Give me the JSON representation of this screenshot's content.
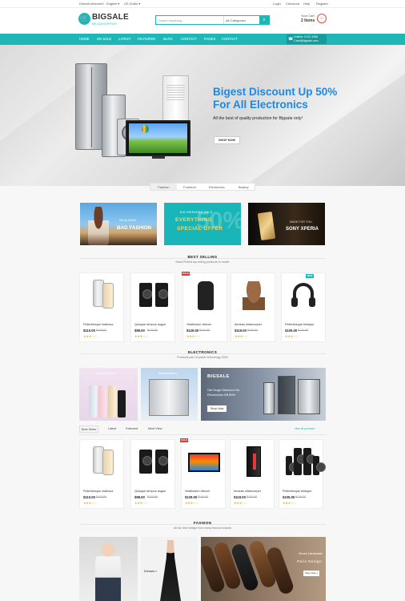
{
  "topbar": {
    "welcome": "Default welcome!",
    "language": "English ▾",
    "currency": "US Dollar ▾",
    "links": [
      "Login",
      "Checkout",
      "Help",
      "Register"
    ]
  },
  "header": {
    "logo": "BIGSALE",
    "logo_sub": "MEGASHOPPING",
    "search_placeholder": "Search anything...",
    "category": "All Categories",
    "cart_label": "Your Cart",
    "cart_count": "2 Items"
  },
  "nav": {
    "items": [
      "HOME",
      "ON SALE",
      "LATEST",
      "FEATURED",
      "BLOG",
      "CONTACT",
      "PAGES",
      "CONTACT"
    ],
    "hotline": "Hotline: 0123 4356",
    "email": "Care@bigsale.com"
  },
  "hero": {
    "title_line1": "Bigest Discount Up 50%",
    "title_line2": "For All Electronics",
    "subtitle": "All the best of quality production for Bigsale only!",
    "button": "SHOP NOW"
  },
  "category_tabs": [
    "Fashion",
    "Furniture",
    "Electronics",
    "Beauty"
  ],
  "banners": {
    "b1": {
      "small": "Get Up to 50%",
      "title": "BAG FASHION"
    },
    "b2": {
      "small": "BIG WEEKEND SALE",
      "line1": "EVERYTHING",
      "line2": "SPECIAL OFFER",
      "big": "50%"
    },
    "b3": {
      "small": "MADE FOR YOU",
      "title": "SONY XPERIA"
    }
  },
  "best_selling": {
    "title": "BEST SELLING",
    "subtitle": "Hand Picked top selling products in month",
    "products": [
      {
        "name": "Pellentesque malesua",
        "price": "$110.00",
        "old": "$120.00",
        "badge": ""
      },
      {
        "name": "Quisque tempus augue",
        "price": "$98.00",
        "old": "$120.00",
        "badge": ""
      },
      {
        "name": "Vestibulum dictum",
        "price": "$129.00",
        "old": "$140.00",
        "badge": "SALE"
      },
      {
        "name": "Aenean ullamcorper",
        "price": "$119.00",
        "old": "$130.00",
        "badge": ""
      },
      {
        "name": "Pellentesque tristique",
        "price": "$105.00",
        "old": "$120.00",
        "badge": "NEW"
      }
    ]
  },
  "electronics": {
    "title": "ELECTRONICS",
    "subtitle": "Products part of power technology 2016",
    "panel1": "Smart Phone »",
    "panel2": "Refrigerators »",
    "promo_title": "BIGSALE",
    "promo_line1": "Get Huge Discount On",
    "promo_line2": "Electronics Off 50%",
    "promo_button": "Shop Now",
    "tabs": [
      "Best Seller",
      "Latest",
      "Featured",
      "Most View"
    ],
    "view_all": "view all products",
    "products": [
      {
        "name": "Pellentesque malesua",
        "price": "$110.00",
        "old": "$120.00",
        "badge": ""
      },
      {
        "name": "Quisque tempus augue",
        "price": "$98.00",
        "old": "$120.00",
        "badge": ""
      },
      {
        "name": "Vestibulum dictum",
        "price": "$129.00",
        "old": "$140.00",
        "badge": "SALE"
      },
      {
        "name": "Aenean ullamcorper",
        "price": "$119.00",
        "old": "$130.00",
        "badge": ""
      },
      {
        "name": "Pellentesque tristique",
        "price": "$105.00",
        "old": "$120.00",
        "badge": ""
      }
    ]
  },
  "fashion": {
    "title": "FASHION",
    "subtitle": "All the best design from many famous brands",
    "panel2": "Dresses »",
    "shoes_small": "Shoes Handmade",
    "shoes_title": "Paris Design",
    "shoes_button": "Shop Now »"
  },
  "stars": "★★★☆☆",
  "colors": {
    "accent": "#21b6b6",
    "hero_title": "#1e88e5",
    "sale": "#e53935"
  }
}
